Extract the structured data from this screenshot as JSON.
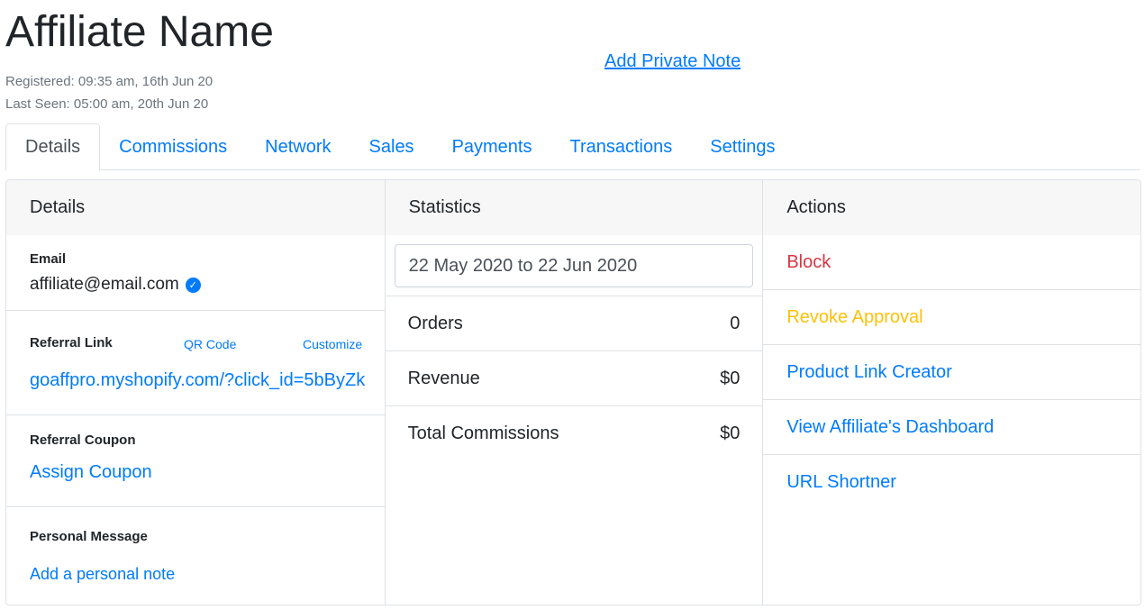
{
  "header": {
    "title": "Affiliate Name",
    "registered": "Registered: 09:35 am, 16th Jun 20",
    "last_seen": "Last Seen: 05:00 am, 20th Jun 20",
    "private_note_link": "Add Private Note"
  },
  "tabs": [
    {
      "label": "Details",
      "active": true
    },
    {
      "label": "Commissions",
      "active": false
    },
    {
      "label": "Network",
      "active": false
    },
    {
      "label": "Sales",
      "active": false
    },
    {
      "label": "Payments",
      "active": false
    },
    {
      "label": "Transactions",
      "active": false
    },
    {
      "label": "Settings",
      "active": false
    }
  ],
  "details": {
    "header": "Details",
    "email_label": "Email",
    "email_value": "affiliate@email.com",
    "verified_icon": "check-circle-icon",
    "referral_link_label": "Referral Link",
    "qr_code_link": "QR Code",
    "customize_link": "Customize",
    "referral_url": "goaffpro.myshopify.com/?click_id=5bByZk",
    "referral_coupon_label": "Referral Coupon",
    "assign_coupon_link": "Assign Coupon",
    "personal_message_label": "Personal Message",
    "add_note_link": "Add a personal note"
  },
  "statistics": {
    "header": "Statistics",
    "date_range": "22 May 2020 to 22 Jun 2020",
    "rows": [
      {
        "label": "Orders",
        "value": "0"
      },
      {
        "label": "Revenue",
        "value": "$0"
      },
      {
        "label": "Total Commissions",
        "value": "$0"
      }
    ]
  },
  "actions": {
    "header": "Actions",
    "items": [
      {
        "label": "Block",
        "color": "#dc3545"
      },
      {
        "label": "Revoke Approval",
        "color": "#ffc107"
      },
      {
        "label": "Product Link Creator",
        "color": "#007bff"
      },
      {
        "label": "View Affiliate's Dashboard",
        "color": "#007bff"
      },
      {
        "label": "URL Shortner",
        "color": "#007bff"
      }
    ]
  },
  "colors": {
    "link": "#007bff",
    "danger": "#dc3545",
    "warning": "#ffc107",
    "muted": "#6c757d"
  }
}
